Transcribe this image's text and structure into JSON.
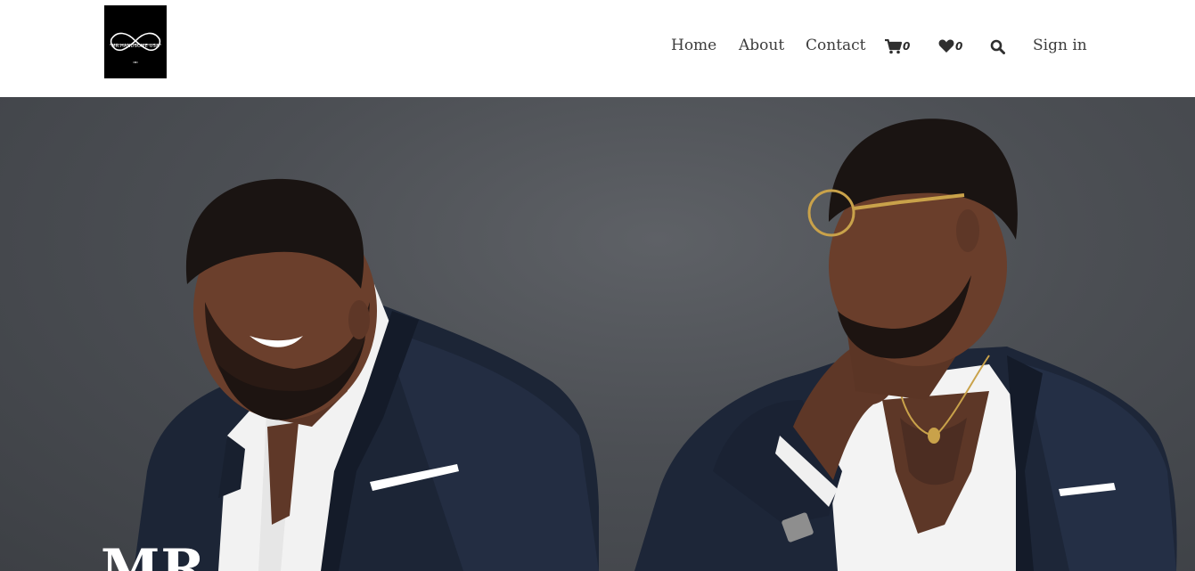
{
  "logo": {
    "text": "MR.HANDSOME USA",
    "alt_name": "brand-logo"
  },
  "nav": {
    "items": [
      {
        "label": "Home"
      },
      {
        "label": "About"
      },
      {
        "label": "Contact"
      }
    ],
    "cart": {
      "icon": "cart-icon",
      "count": "0"
    },
    "wishlist": {
      "icon": "heart-icon",
      "count": "0"
    },
    "search": {
      "icon": "search-icon"
    },
    "signin_label": "Sign in"
  },
  "hero": {
    "title": "MR"
  },
  "colors": {
    "nav_text": "#3c3c3c",
    "hero_bg": "#4c4f54",
    "header_bg": "#ffffff",
    "logo_bg": "#000000"
  }
}
